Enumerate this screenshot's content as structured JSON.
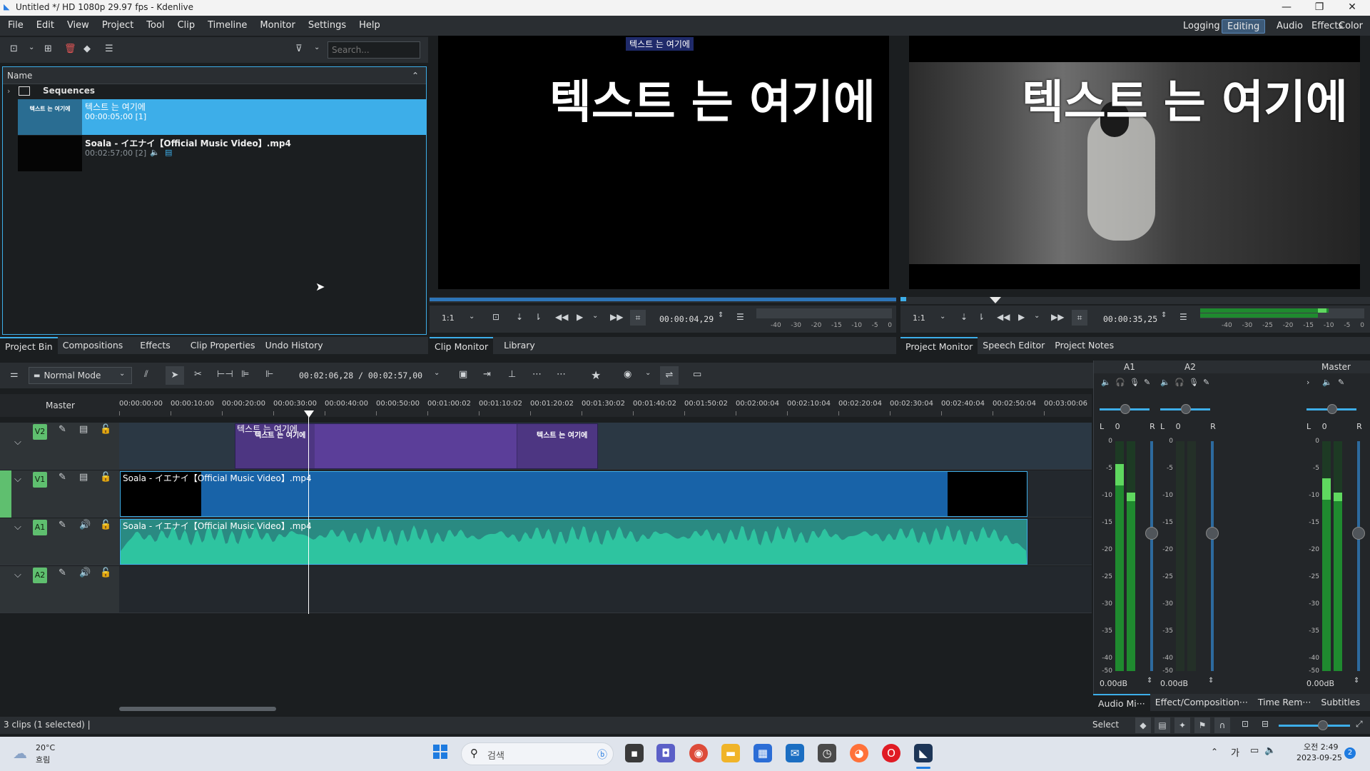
{
  "window": {
    "title": "Untitled */ HD 1080p 29.97 fps - Kdenlive",
    "minimize": "—",
    "maximize": "❐",
    "close": "✕"
  },
  "menu": [
    "File",
    "Edit",
    "View",
    "Project",
    "Tool",
    "Clip",
    "Timeline",
    "Monitor",
    "Settings",
    "Help"
  ],
  "workspaces": [
    "Logging",
    "Editing",
    "Audio",
    "Effects",
    "Color"
  ],
  "active_workspace": "Editing",
  "bin": {
    "search_placeholder": "Search...",
    "header": "Name",
    "folder": "Sequences",
    "items": [
      {
        "thumb_text": "텍스트 는 여기에",
        "name": "텍스트 는 여기에",
        "meta": "00:00:05;00 [1]",
        "selected": true
      },
      {
        "thumb_text": "",
        "name": "Soala - イエナイ【Official Music Video】.mp4",
        "meta": "00:02:57;00 [2]",
        "selected": false
      }
    ]
  },
  "left_tabs": [
    "Project Bin",
    "Compositions",
    "Effects",
    "Clip Properties",
    "Undo History"
  ],
  "clip_monitor": {
    "overlay_label": "텍스트 는 여기에",
    "big_text": "텍스트 는 여기에",
    "zoom": "1:1",
    "timecode": "00:00:04,29",
    "tabs": [
      "Clip Monitor",
      "Library"
    ],
    "meter_scale": [
      "-40",
      "-30",
      "-20",
      "-15",
      "-10",
      "-5",
      "0"
    ]
  },
  "project_monitor": {
    "big_text": "텍스트 는 여기에",
    "zoom": "1:1",
    "timecode": "00:00:35,25",
    "tabs": [
      "Project Monitor",
      "Speech Editor",
      "Project Notes"
    ],
    "meter_scale": [
      "-40",
      "-30",
      "-25",
      "-20",
      "-15",
      "-10",
      "-5",
      "0"
    ]
  },
  "timeline": {
    "mode": "Normal Mode",
    "position": "00:02:06,28 / 00:02:57,00",
    "master_label": "Master",
    "ruler": [
      "00:00:00:00",
      "00:00:10:00",
      "00:00:20:00",
      "00:00:30:00",
      "00:00:40:00",
      "00:00:50:00",
      "00:01:00:02",
      "00:01:10:02",
      "00:01:20:02",
      "00:01:30:02",
      "00:01:40:02",
      "00:01:50:02",
      "00:02:00:04",
      "00:02:10:04",
      "00:02:20:04",
      "00:02:30:04",
      "00:02:40:04",
      "00:02:50:04",
      "00:03:00:06"
    ],
    "tracks": [
      {
        "name": "V2",
        "type": "video"
      },
      {
        "name": "V1",
        "type": "video"
      },
      {
        "name": "A1",
        "type": "audio"
      },
      {
        "name": "A2",
        "type": "audio"
      }
    ],
    "title_clip_label": "텍스트 는 여기에",
    "title_clip_inner": [
      "텍스트 는 여기에",
      "텍스트 는 여기에"
    ],
    "video_clip_label": "Soala - イエナイ【Official Music Video】.mp4",
    "audio_clip_label": "Soala - イエナイ【Official Music Video】.mp4"
  },
  "mixer": {
    "channels": [
      "A1",
      "A2"
    ],
    "master": "Master",
    "pan_value": "0",
    "L": "L",
    "R": "R",
    "db_values": [
      "0.00dB",
      "0.00dB",
      "0.00dB"
    ],
    "scale": [
      "0",
      "-5",
      "-10",
      "-15",
      "-20",
      "-25",
      "-30",
      "-35",
      "-40",
      "-50"
    ],
    "tabs": [
      "Audio Mi···",
      "Effect/Composition···",
      "Time Rem···",
      "Subtitles"
    ]
  },
  "status": {
    "clips": "3 clips (1 selected) |",
    "select": "Select"
  },
  "taskbar": {
    "weather_temp": "20°C",
    "weather_desc": "흐림",
    "search": "검색",
    "ime": "가",
    "time": "오전 2:49",
    "date": "2023-09-25",
    "notif": "2"
  }
}
